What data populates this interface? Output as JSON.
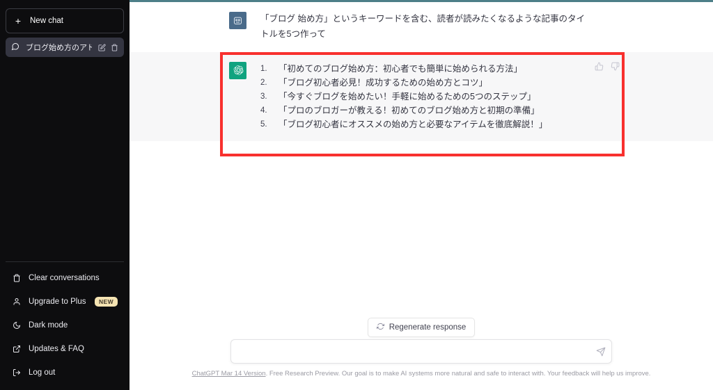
{
  "theme": {
    "sidebar_bg": "#0d0d0f",
    "assistant_bg": "#f7f7f8",
    "accent_green": "#10a37f",
    "annotation_red": "#f8302e",
    "badge_yellow": "#f4e3b2",
    "top_strip": "#4d7f88"
  },
  "sidebar": {
    "new_chat": {
      "label": "New chat",
      "icon": "plus-icon"
    },
    "conversations": [
      {
        "title": "ブログ始め方のアドバ",
        "icon": "chat-bubble-icon",
        "edit_icon": "pencil-icon",
        "delete_icon": "trash-icon",
        "active": true
      }
    ],
    "menu": [
      {
        "label": "Clear conversations",
        "icon": "trash-icon",
        "badge": ""
      },
      {
        "label": "Upgrade to Plus",
        "icon": "user-icon",
        "badge": "NEW"
      },
      {
        "label": "Dark mode",
        "icon": "moon-icon",
        "badge": ""
      },
      {
        "label": "Updates & FAQ",
        "icon": "external-link-icon",
        "badge": ""
      },
      {
        "label": "Log out",
        "icon": "logout-icon",
        "badge": ""
      }
    ]
  },
  "conversation": {
    "user_message": {
      "avatar": "user-avatar",
      "text": "「ブログ 始め方」というキーワードを含む、読者が読みたくなるような記事のタイトルを5つ作って"
    },
    "assistant_message": {
      "avatar": "chatgpt-logo",
      "items": [
        "「初めてのブログ始め方：初心者でも簡単に始められる方法」",
        "「ブログ初心者必見！成功するための始め方とコツ」",
        "「今すぐブログを始めたい！手軽に始めるための5つのステップ」",
        "「プロのブロガーが教える！初めてのブログ始め方と初期の準備」",
        "「ブログ初心者にオススメの始め方と必要なアイテムを徹底解説！」"
      ],
      "thumbs_up_icon": "thumbs-up-icon",
      "thumbs_down_icon": "thumbs-down-icon"
    }
  },
  "composer": {
    "regenerate_label": "Regenerate response",
    "regenerate_icon": "refresh-icon",
    "input_value": "",
    "input_placeholder": "",
    "send_icon": "send-icon"
  },
  "footer": {
    "version_link": "ChatGPT Mar 14 Version",
    "text": ". Free Research Preview. Our goal is to make AI systems more natural and safe to interact with. Your feedback will help us improve."
  }
}
